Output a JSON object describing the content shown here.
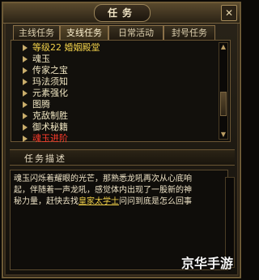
{
  "window": {
    "title": "任务",
    "close_icon": "close-icon"
  },
  "tabs": [
    {
      "label": "主线任务",
      "active": false
    },
    {
      "label": "支线任务",
      "active": true
    },
    {
      "label": "日常活动",
      "active": false
    },
    {
      "label": "封号任务",
      "active": false
    }
  ],
  "task_list": [
    {
      "label": "等级22 婚姻殿堂",
      "color": "yellow"
    },
    {
      "label": "魂玉",
      "color": "normal"
    },
    {
      "label": "传家之宝",
      "color": "normal"
    },
    {
      "label": "玛法须知",
      "color": "normal"
    },
    {
      "label": "元素强化",
      "color": "normal"
    },
    {
      "label": "图腾",
      "color": "normal"
    },
    {
      "label": "克敌制胜",
      "color": "normal"
    },
    {
      "label": "御术秘籍",
      "color": "normal"
    },
    {
      "label": "魂玉进阶",
      "color": "red"
    }
  ],
  "description": {
    "header": "任务描述",
    "line1": "魂玉闪烁着耀眼的光芒，那熟悉龙吼再次从心底响",
    "line2": "起，伴随着一声龙吼，感觉体内出现了一股新的神",
    "line3a": "秘力量，赶快去找",
    "highlight": "皇家太学士",
    "line3b": "问问到底是怎么回事"
  },
  "watermark": "京华手游"
}
